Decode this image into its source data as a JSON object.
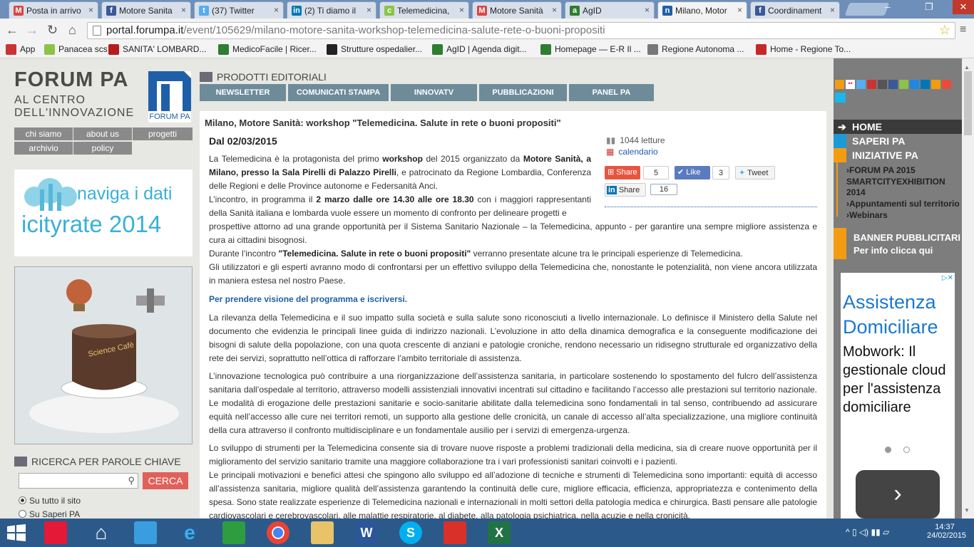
{
  "browser": {
    "tabs": [
      {
        "label": "Posta in arrivo",
        "icon": "M",
        "color": "#d44"
      },
      {
        "label": "Motore Sanita",
        "icon": "f",
        "color": "#3b5998"
      },
      {
        "label": "(37) Twitter",
        "icon": "t",
        "color": "#55acee"
      },
      {
        "label": "(2) Ti diamo il",
        "icon": "in",
        "color": "#0077b5"
      },
      {
        "label": "Telemedicina,",
        "icon": "c",
        "color": "#8bc34a"
      },
      {
        "label": "Motore Sanità",
        "icon": "M",
        "color": "#d44"
      },
      {
        "label": "AgID",
        "icon": "a",
        "color": "#2e7d32"
      },
      {
        "label": "Milano, Motor",
        "icon": "n",
        "color": "#1f5fa8"
      },
      {
        "label": "Coordinament",
        "icon": "f",
        "color": "#3b5998"
      }
    ],
    "url_host": "portal.forumpa.it",
    "url_path": "/event/105629/milano-motore-sanita-workshop-telemedicina-salute-rete-o-buoni-propositi",
    "bookmarks": [
      {
        "label": "App",
        "color": "#c33"
      },
      {
        "label": "Panacea scs",
        "color": "#8bc34a"
      },
      {
        "label": "SANITA' LOMBARD...",
        "color": "#b71c1c"
      },
      {
        "label": "MedicoFacile | Ricer...",
        "color": "#2e7d32"
      },
      {
        "label": "Strutture ospedalier...",
        "color": "#222"
      },
      {
        "label": "AgID | Agenda digit...",
        "color": "#2e7d32"
      },
      {
        "label": "Homepage — E-R Il ...",
        "color": "#2e7d32"
      },
      {
        "label": "Regione Autonoma ...",
        "color": "#777"
      },
      {
        "label": "Home - Regione To...",
        "color": "#c62828"
      }
    ]
  },
  "site": {
    "logo_title": "FORUM PA",
    "logo_line1": "AL CENTRO",
    "logo_line2": "DELL'INNOVAZIONE",
    "logo_badge": "FORUM PA",
    "menu": [
      "chi siamo",
      "about us",
      "progetti",
      "archivio",
      "policy"
    ],
    "banner1_a": "naviga i dati",
    "banner1_b": "icityrate 2014",
    "banner2_text": "Science Cafè",
    "search_heading": "RICERCA PER PAROLE CHIAVE",
    "search_button": "CERCA",
    "search_opt1": "Su tutto il sito",
    "search_opt2": "Su Saperi PA",
    "products_heading": "PRODOTTI EDITORIALI",
    "product_tabs": [
      "NEWSLETTER",
      "COMUNICATI STAMPA",
      "INNOVATV",
      "PUBBLICAZIONI",
      "PANEL PA"
    ]
  },
  "article": {
    "title": "Milano, Motore Sanità: workshop \"Telemedicina. Salute in rete o buoni propositi\"",
    "date": "Dal 02/03/2015",
    "reads": "1044 letture",
    "calendar": "calendario",
    "share_label": "Share",
    "share_count": "5",
    "like_label": "Like",
    "like_count": "3",
    "tweet_label": "Tweet",
    "li_share": "Share",
    "li_count": "16",
    "p1a": "La Telemedicina è la protagonista del primo ",
    "p1b": "workshop",
    "p1c": " del 2015 organizzato da ",
    "p1d": "Motore Sanità, a",
    "p1e": "Milano, presso la  Sala Pirelli di Palazzo Pirelli",
    "p1f": ", e patrocinato da Regione Lombardia, Conferenza",
    "p1g": "delle Regioni e delle Province autonome e Federsanità Anci.",
    "p2a": "L’incontro, in programma il ",
    "p2b": "2 marzo dalle ore 14.30 alle ore 18.30",
    "p2c": " con i maggiori rappresentanti",
    "p2d": "della Sanità italiana e lombarda vuole essere un momento di confronto per delineare progetti e",
    "p2e": "prospettive attorno ad una grande opportunità per il Sistema Sanitario Nazionale – la Telemedicina, appunto - per garantire una sempre migliore assistenza e cura ai cittadini bisognosi.",
    "p3a": "Durante l’incontro ",
    "p3b": "\"Telemedicina. Salute in rete o buoni propositi\"",
    "p3c": " verranno presentate alcune tra le principali esperienze di Telemedicina.",
    "p4": "Gli utilizzatori e gli esperti avranno modo di confrontarsi per un effettivo sviluppo della Telemedicina che, nonostante le potenzialità, non viene ancora utilizzata in maniera estesa nel nostro Paese.",
    "link": "Per prendere visione del programma e iscriversi.",
    "p5": "La rilevanza della Telemedicina e il suo impatto sulla società e sulla salute sono riconosciuti a livello internazionale. Lo definisce il Ministero della Salute nel documento che evidenzia le principali linee guida di indirizzo nazionali. L’evoluzione in atto della dinamica demografica e la conseguente modificazione dei bisogni di salute della popolazione, con una quota crescente di anziani e patologie croniche, rendono necessario un ridisegno strutturale ed organizzativo della rete dei servizi, soprattutto nell’ottica di rafforzare l’ambito territoriale di assistenza.",
    "p6": "L’innovazione tecnologica può contribuire a una riorganizzazione dell’assistenza sanitaria, in particolare sostenendo lo spostamento del fulcro dell’assistenza sanitaria dall’ospedale al territorio, attraverso modelli assistenziali innovativi incentrati sul cittadino e facilitando l’accesso alle prestazioni sul territorio nazionale. Le modalità di erogazione delle prestazioni sanitarie e socio-sanitarie abilitate dalla telemedicina sono fondamentali in tal senso, contribuendo ad assicurare equità nell’accesso alle cure nei territori remoti, un supporto alla gestione delle cronicità, un canale di accesso all’alta specializzazione, una migliore continuità della cura attraverso il confronto multidisciplinare e un fondamentale ausilio per i servizi di emergenza-urgenza.",
    "p7": "Lo sviluppo di strumenti per la Telemedicina consente sia di trovare nuove risposte a problemi tradizionali della medicina, sia di creare nuove opportunità per il miglioramento del servizio sanitario tramite una maggiore collaborazione tra i vari professionisti sanitari coinvolti e i pazienti.",
    "p8": "Le principali motivazioni e benefici attesi che spingono allo sviluppo ed all’adozione di tecniche e strumenti di Telemedicina sono importanti: equità di accesso all’assistenza sanitaria, migliore qualità dell’assistenza garantendo la continuità delle cure, migliore efficacia, efficienza, appropriatezza e contenimento della spesa. Sono state realizzate esperienze di Telemedicina nazionali e internazionali in molti settori della patologia medica e chirurgica. Basti pensare alle patologie cardiovascolari e cerebrovascolari, alle malattie respiratorie, al diabete, alla patologia psichiatrica, nella acuzie e nella cronicità."
  },
  "right": {
    "menu": [
      "HOME",
      "SAPERI PA",
      "INIZIATIVE PA"
    ],
    "links": [
      "FORUM PA 2015",
      "SMARTCITYEXHIBITION 2014",
      "Appuntamenti sul territorio",
      "Webinars"
    ],
    "banner_a": "BANNER PUBBLICITARI",
    "banner_b": "Per info clicca qui",
    "ad_headline": "Assistenza Domiciliare",
    "ad_text": "Mobwork: Il gestionale cloud per l'assistenza domiciliare",
    "accent": "#f39c12"
  },
  "taskbar": {
    "time": "14:37",
    "date": "24/02/2015"
  }
}
